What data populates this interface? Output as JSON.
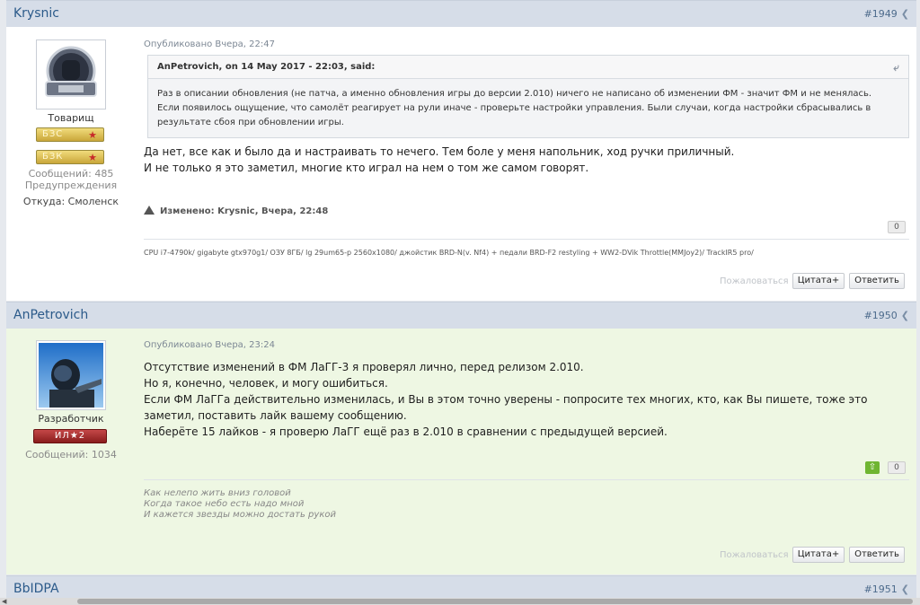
{
  "posts": [
    {
      "author": "Krysnic",
      "number": "#1949",
      "rank": "Товарищ",
      "badges": [
        "БЗС",
        "БЗК"
      ],
      "posts_count": "Сообщений: 485",
      "warnings": "Предупреждения",
      "location": "Откуда: Смоленск",
      "posted": "Опубликовано Вчера, 22:47",
      "quote": {
        "header": "AnPetrovich, on 14 May 2017 - 22:03, said:",
        "lines": [
          "Раз в описании обновления (не патча, а именно обновления игры до версии 2.010) ничего не написано об изменении ФМ - значит ФМ и не менялась.",
          "Если появилось ощущение, что самолёт реагирует на рули иначе - проверьте настройки управления. Были случаи, когда настройки сбрасывались в результате сбоя при обновлении игры."
        ]
      },
      "content": [
        "Да нет, все как и было да и настраивать то нечего. Тем боле у меня напольник, ход ручки приличный.",
        "И не только я это заметил, многие кто играл на нем о том же самом говорят."
      ],
      "edited": "Изменено: Krysnic, Вчера, 22:48",
      "reputation": "0",
      "signature": "CPU i7-4790k/ gigabyte gtx970g1/ ОЗУ 8ГБ/ lg 29um65-p 2560x1080/ джойстик BRD-N(v. Nf4) + педали BRD-F2 restyling + WW2-DVik Throttle(MMJoy2)/ TrackIR5 pro/",
      "report_label": "Пожаловаться",
      "quote_button": "Цитата+",
      "reply_button": "Ответить"
    },
    {
      "author": "AnPetrovich",
      "number": "#1950",
      "rank": "Разработчик",
      "badges": [
        "ИЛ★2"
      ],
      "posts_count": "Сообщений: 1034",
      "posted": "Опубликовано Вчера, 23:24",
      "content": [
        "Отсутствие изменений в ФМ ЛаГГ-3 я проверял лично, перед релизом 2.010.",
        "Но я, конечно, человек, и могу ошибиться.",
        "Если ФМ ЛаГГа действительно изменилась, и Вы в этом точно уверены - попросите тех многих, кто, как Вы пишете, тоже это заметил, поставить лайк вашему сообщению.",
        "Наберёте 15 лайков - я проверю ЛаГГ ещё раз в 2.010 в сравнении с предыдущей версией."
      ],
      "reputation": "0",
      "signature_lines": [
        "Как нелепо жить вниз головой",
        "Когда такое небо есть надо мной",
        "И кажется звезды можно достать рукой"
      ],
      "report_label": "Пожаловаться",
      "quote_button": "Цитата+",
      "reply_button": "Ответить"
    },
    {
      "author": "BbIDPA",
      "number": "#1951"
    }
  ],
  "colors": {
    "accent": "#2b5a8a",
    "header_bg": "#d6dde8",
    "dev_post_bg": "#eef7e3",
    "like": "#6fb532"
  }
}
